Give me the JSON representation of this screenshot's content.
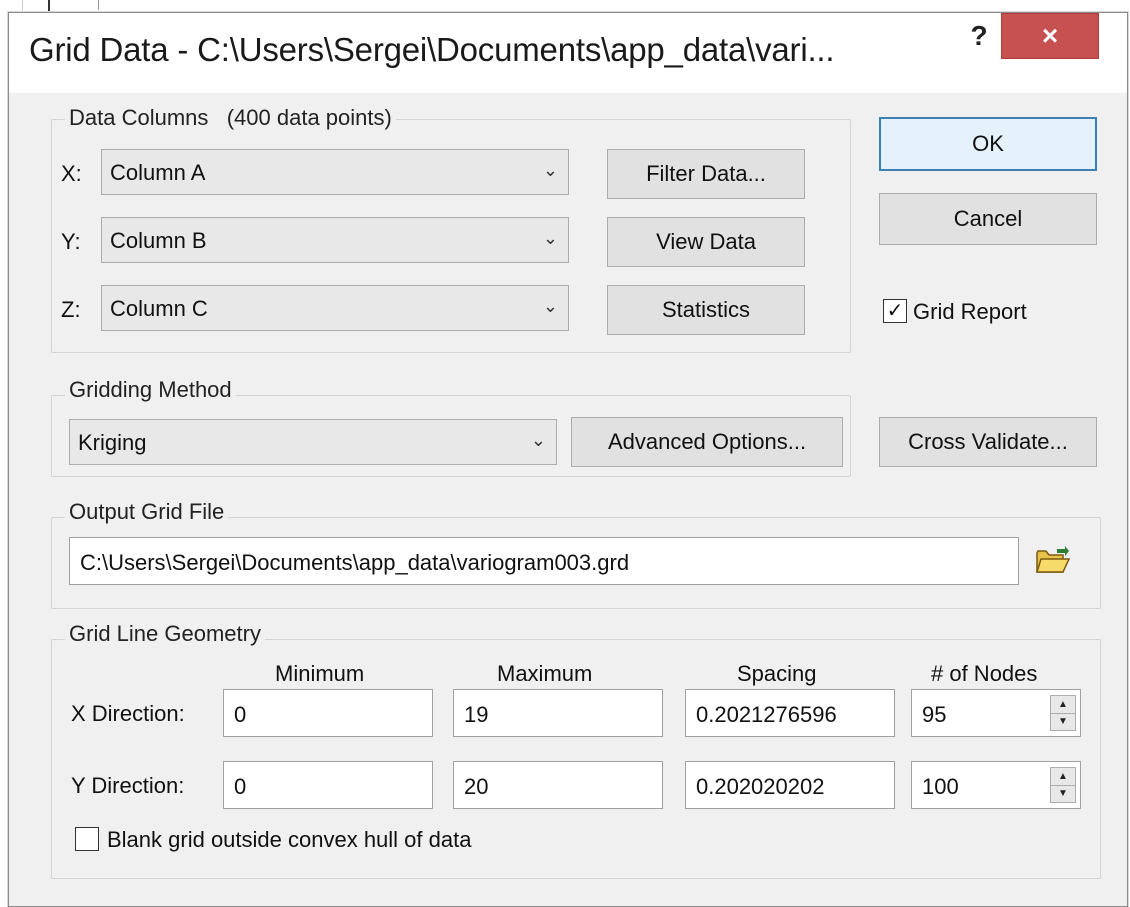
{
  "window": {
    "title": "Grid Data - C:\\Users\\Sergei\\Documents\\app_data\\vari...",
    "help_label": "?",
    "close_label": "×"
  },
  "data_columns": {
    "label": "Data Columns",
    "count_text": "(400 data points)",
    "x_label": "X:",
    "x_value": "Column A",
    "y_label": "Y:",
    "y_value": "Column B",
    "z_label": "Z:",
    "z_value": "Column C",
    "filter_button": "Filter Data...",
    "view_button": "View Data",
    "statistics_button": "Statistics"
  },
  "actions": {
    "ok_label": "OK",
    "cancel_label": "Cancel",
    "grid_report_label": "Grid Report",
    "grid_report_checked": true
  },
  "gridding_method": {
    "label": "Gridding Method",
    "value": "Kriging",
    "advanced_button": "Advanced Options...",
    "cross_validate_button": "Cross Validate..."
  },
  "output_grid": {
    "label": "Output Grid File",
    "path": "C:\\Users\\Sergei\\Documents\\app_data\\variogram003.grd"
  },
  "grid_geometry": {
    "label": "Grid Line Geometry",
    "col_minimum": "Minimum",
    "col_maximum": "Maximum",
    "col_spacing": "Spacing",
    "col_nodes": "# of Nodes",
    "x_label": "X Direction:",
    "x_min": "0",
    "x_max": "19",
    "x_spacing": "0.2021276596",
    "x_nodes": "95",
    "y_label": "Y Direction:",
    "y_min": "0",
    "y_max": "20",
    "y_spacing": "0.202020202",
    "y_nodes": "100",
    "blank_label": "Blank grid outside convex hull of data",
    "blank_checked": false
  },
  "icons": {
    "folder": "open-folder-icon",
    "dropdown": "chevron-down-icon"
  }
}
